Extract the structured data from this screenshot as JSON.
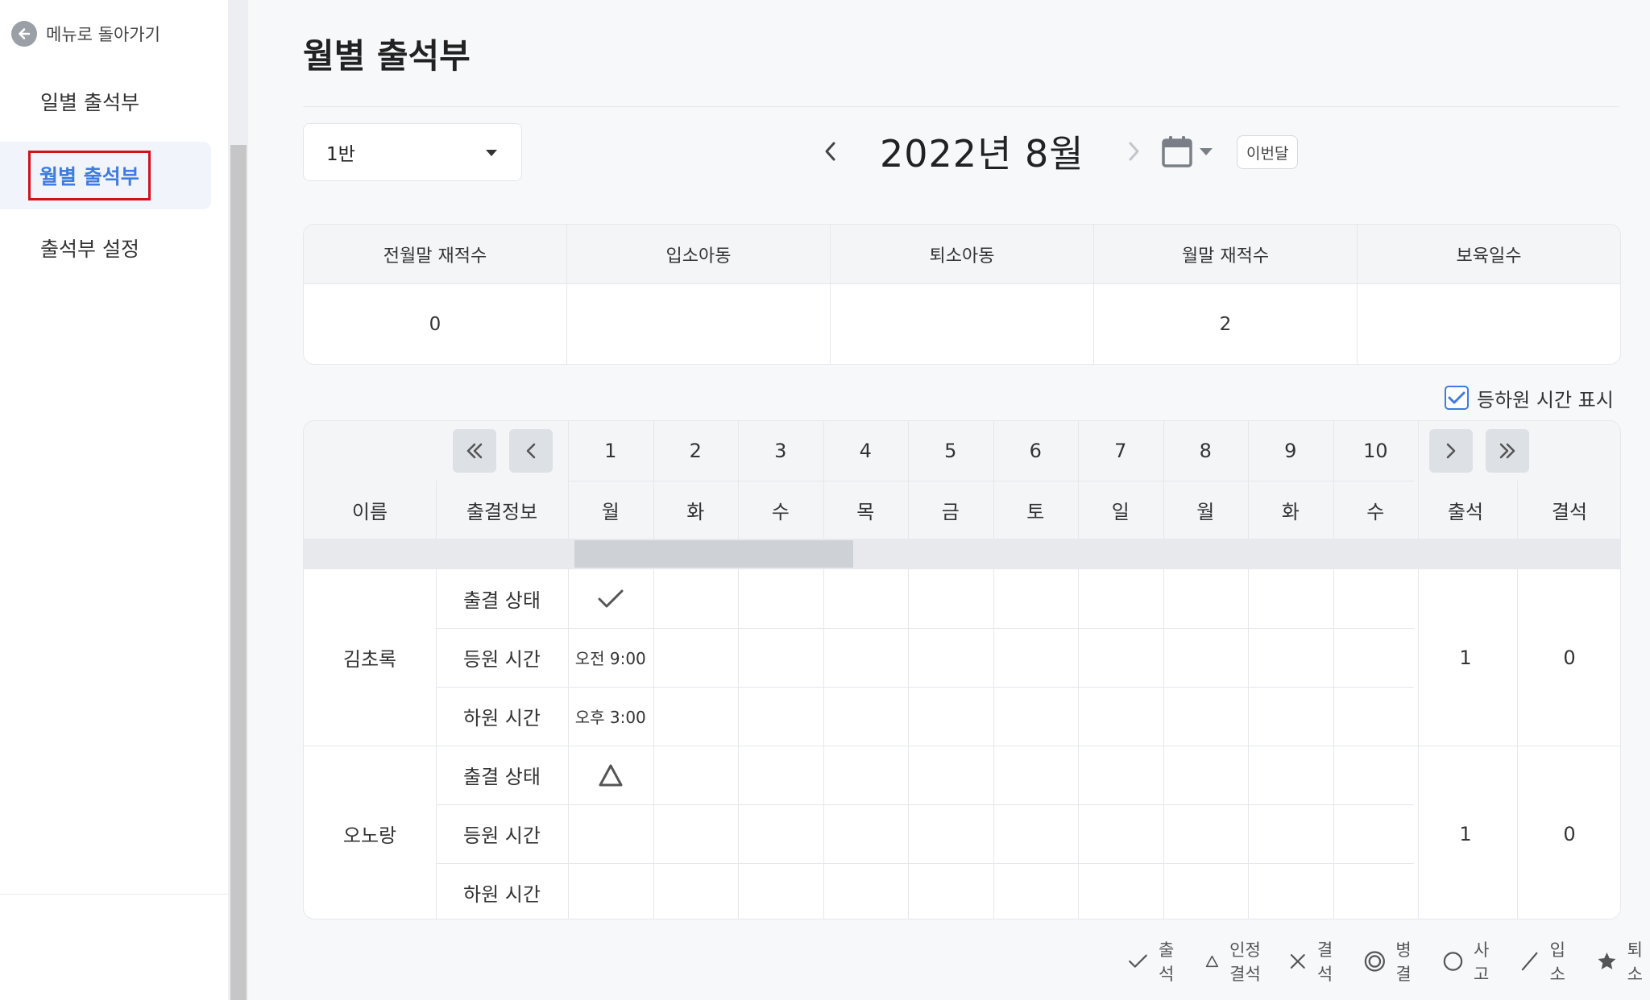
{
  "sidebar": {
    "back_label": "메뉴로 돌아가기",
    "items": [
      {
        "label": "일별 출석부",
        "active": false
      },
      {
        "label": "월별 출석부",
        "active": true
      },
      {
        "label": "출석부 설정",
        "active": false
      }
    ]
  },
  "page": {
    "title": "월별 출석부",
    "class_select": "1반",
    "month_label": "2022년 8월",
    "this_month_label": "이번달"
  },
  "summary": {
    "headers": [
      "전월말 재적수",
      "입소아동",
      "퇴소아동",
      "월말 재적수",
      "보육일수"
    ],
    "values": [
      "0",
      "",
      "",
      "2",
      ""
    ]
  },
  "toggle": {
    "label": "등하원 시간 표시",
    "checked": true
  },
  "attendance": {
    "col_name": "이름",
    "col_info": "출결정보",
    "dates": [
      "1",
      "2",
      "3",
      "4",
      "5",
      "6",
      "7",
      "8",
      "9",
      "10"
    ],
    "weekdays": [
      "월",
      "화",
      "수",
      "목",
      "금",
      "토",
      "일",
      "월",
      "화",
      "수"
    ],
    "col_present": "출석",
    "col_absent": "결석",
    "row_labels": [
      "출결 상태",
      "등원 시간",
      "하원 시간"
    ],
    "students": [
      {
        "name": "김초록",
        "status_day1": "check-icon",
        "arrive_day1": "오전 9:00",
        "leave_day1": "오후 3:00",
        "present": "1",
        "absent": "0"
      },
      {
        "name": "오노랑",
        "status_day1": "triangle-icon",
        "arrive_day1": "",
        "leave_day1": "",
        "present": "1",
        "absent": "0"
      }
    ]
  },
  "legend": [
    {
      "icon": "check-icon",
      "label": "출석"
    },
    {
      "icon": "triangle-icon",
      "label": "인정 결석"
    },
    {
      "icon": "cross-icon",
      "label": "결석"
    },
    {
      "icon": "double-circle-icon",
      "label": "병결"
    },
    {
      "icon": "circle-icon",
      "label": "사고"
    },
    {
      "icon": "slash-icon",
      "label": "입소"
    },
    {
      "icon": "star-icon",
      "label": "퇴소"
    }
  ],
  "colors": {
    "accent": "#3f7be0",
    "highlight_border": "#d0121b",
    "header_bg": "#f4f5f7"
  }
}
